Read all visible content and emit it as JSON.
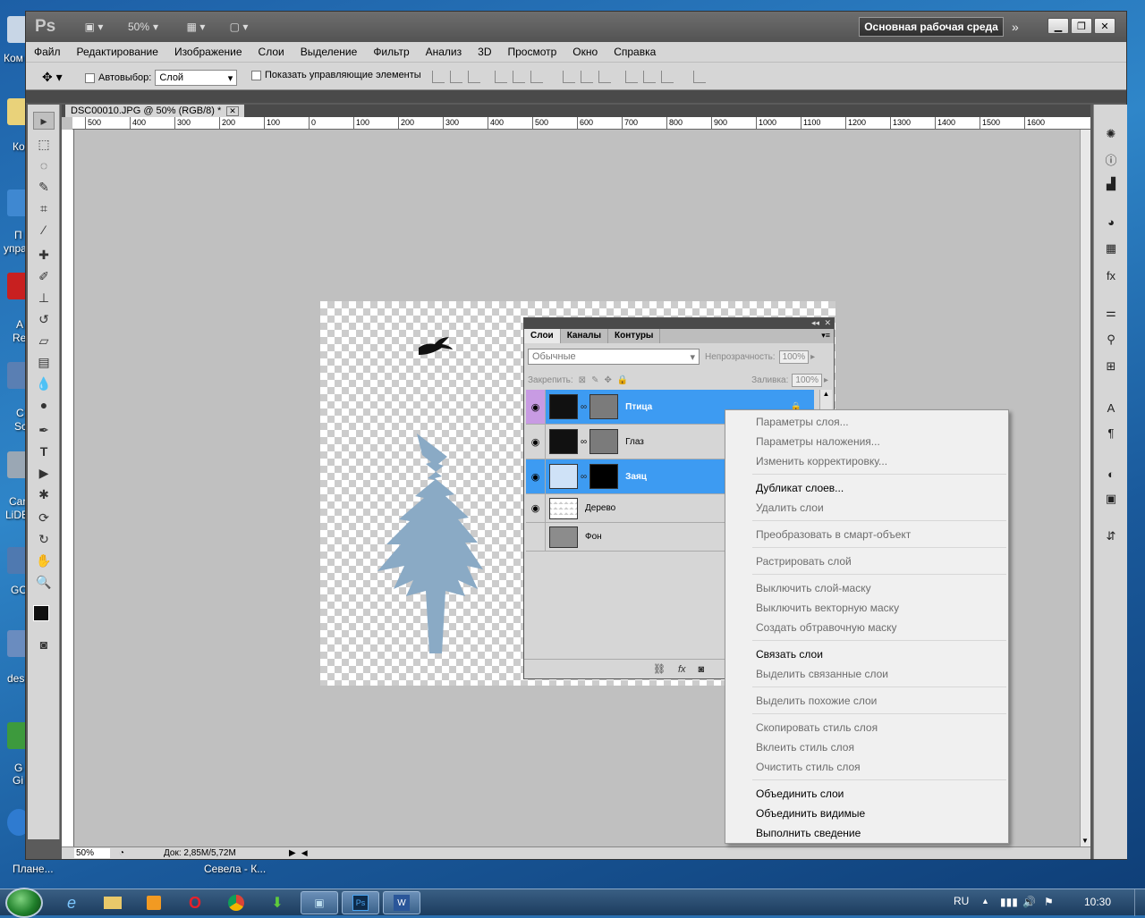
{
  "desktop": {
    "labels": [
      "Ком",
      "Ко",
      "П",
      "упра",
      "А",
      "Re",
      "С",
      "Sc",
      "Can",
      "LiDE",
      "GO",
      "des",
      "G",
      "Gi",
      "Планe...",
      "Севела - К..."
    ]
  },
  "app": {
    "logo": "Ps",
    "zoom": "50%",
    "workspace": "Основная рабочая среда",
    "menu": [
      "Файл",
      "Редактирование",
      "Изображение",
      "Слои",
      "Выделение",
      "Фильтр",
      "Анализ",
      "3D",
      "Просмотр",
      "Окно",
      "Справка"
    ],
    "options": {
      "autoselect_label": "Автовыбор:",
      "autoselect_value": "Слой",
      "show_controls_label": "Показать управляющие элементы"
    },
    "document": {
      "tab_title": "DSC00010.JPG @ 50% (RGB/8) *",
      "status_zoom": "50%",
      "status_doc": "Док: 2,85M/5,72M"
    },
    "ruler_h": [
      "500",
      "400",
      "300",
      "200",
      "100",
      "0",
      "100",
      "200",
      "300",
      "400",
      "500",
      "600",
      "700",
      "800",
      "900",
      "1000",
      "1100",
      "1200",
      "1300",
      "1400",
      "1500",
      "1600"
    ]
  },
  "layers_panel": {
    "tabs": [
      "Слои",
      "Каналы",
      "Контуры"
    ],
    "blend_mode": "Обычные",
    "opacity_label": "Непрозрачность:",
    "opacity_value": "100%",
    "lock_label": "Закрепить:",
    "fill_label": "Заливка:",
    "fill_value": "100%",
    "layers": [
      {
        "name": "Птица",
        "selected": true
      },
      {
        "name": "Глаз",
        "selected": false
      },
      {
        "name": "Заяц",
        "selected": true
      },
      {
        "name": "Дерево",
        "selected": false
      },
      {
        "name": "Фон",
        "selected": false
      }
    ]
  },
  "context_menu": {
    "groups": [
      [
        {
          "label": "Параметры слоя...",
          "enabled": false
        },
        {
          "label": "Параметры наложения...",
          "enabled": false
        },
        {
          "label": "Изменить корректировку...",
          "enabled": false
        }
      ],
      [
        {
          "label": "Дубликат слоев...",
          "enabled": true
        },
        {
          "label": "Удалить слои",
          "enabled": false
        }
      ],
      [
        {
          "label": "Преобразовать в смарт-объект",
          "enabled": false
        }
      ],
      [
        {
          "label": "Растрировать слой",
          "enabled": false
        }
      ],
      [
        {
          "label": "Выключить слой-маску",
          "enabled": false
        },
        {
          "label": "Выключить векторную маску",
          "enabled": false
        },
        {
          "label": "Создать обтравочную маску",
          "enabled": false
        }
      ],
      [
        {
          "label": "Связать слои",
          "enabled": true
        },
        {
          "label": "Выделить связанные слои",
          "enabled": false
        }
      ],
      [
        {
          "label": "Выделить похожие слои",
          "enabled": false
        }
      ],
      [
        {
          "label": "Скопировать стиль слоя",
          "enabled": false
        },
        {
          "label": "Вклеить стиль слоя",
          "enabled": false
        },
        {
          "label": "Очистить стиль слоя",
          "enabled": false
        }
      ],
      [
        {
          "label": "Объединить слои",
          "enabled": true
        },
        {
          "label": "Объединить видимые",
          "enabled": true
        },
        {
          "label": "Выполнить сведение",
          "enabled": true
        }
      ]
    ]
  },
  "taskbar": {
    "lang": "RU",
    "time": "10:30"
  },
  "colors": {
    "selection": "#3d9bf2",
    "selection_eye": "#c89be3",
    "tree": "#8aaac5"
  }
}
